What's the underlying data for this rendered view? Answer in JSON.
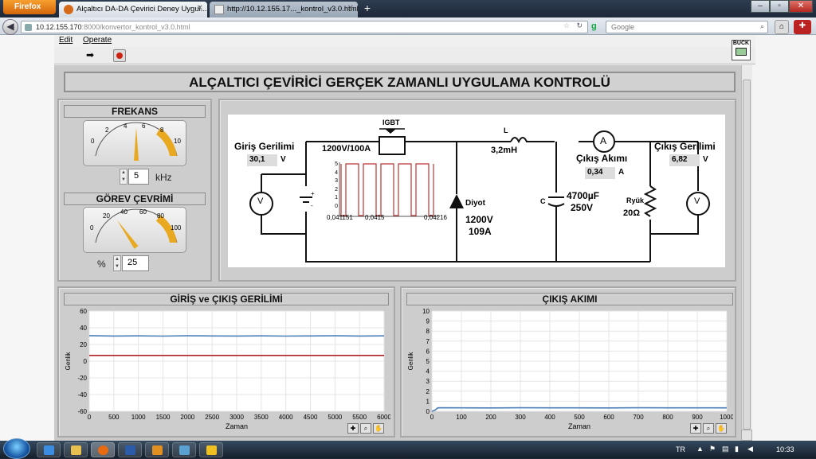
{
  "browser": {
    "firefox_label": "Firefox",
    "tabs": [
      {
        "label": "Alçaltıcı DA-DA Çevirici Deney Uygul...",
        "active": true
      },
      {
        "label": "http://10.12.155.17..._kontrol_v3.0.html",
        "active": false
      }
    ],
    "new_tab": "+",
    "url_host": "10.12.155.170",
    "url_rest": ":8000/konvertor_kontrol_v3.0.html",
    "search_placeholder": "Google",
    "window_buttons": [
      "–",
      "▫",
      "✕"
    ]
  },
  "menu": {
    "items": [
      "Edit",
      "Operate"
    ]
  },
  "badge": {
    "line1": "BUCK"
  },
  "title": "ALÇALTICI ÇEVİRİCİ GERÇEK ZAMANLI UYGULAMA KONTROLÜ",
  "frequency": {
    "title": "FREKANS",
    "scale": [
      "0",
      "2",
      "4",
      "6",
      "8",
      "10"
    ],
    "value": "5",
    "unit": "kHz",
    "needle": 5,
    "max": 10
  },
  "duty": {
    "title": "GÖREV ÇEVRİMİ",
    "scale": [
      "0",
      "20",
      "40",
      "60",
      "80",
      "100"
    ],
    "value": "25",
    "unit": "%",
    "needle": 25,
    "max": 100
  },
  "circuit": {
    "input_voltage_label": "Giriş Gerilimi",
    "input_voltage_value": "30,1",
    "input_voltage_unit": "V",
    "igbt_label": "IGBT",
    "igbt_rating": "1200V/100A",
    "inductor_label": "L",
    "inductor_value": "3,2mH",
    "diode_label": "Diyot",
    "diode_rating_v": "1200V",
    "diode_rating_a": "109A",
    "cap_label": "C",
    "cap_value": "4700µF",
    "cap_voltage": "250V",
    "current_label": "Çıkış Akımı",
    "current_value": "0,34",
    "current_unit": "A",
    "output_voltage_label": "Çıkış Gerilimi",
    "output_voltage_value": "6,82",
    "output_voltage_unit": "V",
    "load_label": "Ryük",
    "load_value": "20Ω",
    "ammeter_symbol": "A",
    "voltmeter_symbol": "V",
    "battery_plus": "+",
    "battery_minus": "-",
    "pwm": {
      "y_ticks": [
        "5",
        "4",
        "3",
        "2",
        "1",
        "0"
      ],
      "x_ticks": [
        "0,041151",
        "0,0415",
        "0,04216"
      ]
    }
  },
  "graph1": {
    "title": "GİRİŞ ve ÇIKIŞ GERİLİMİ",
    "xlabel": "Zaman",
    "ylabel": "Genlik"
  },
  "graph2": {
    "title": "ÇIKIŞ AKIMI",
    "xlabel": "Zaman",
    "ylabel": "Genlik"
  },
  "chart_data": [
    {
      "type": "line",
      "title": "GİRİŞ ve ÇIKIŞ GERİLİMİ",
      "xlabel": "Zaman",
      "ylabel": "Genlik",
      "xlim": [
        0,
        6000
      ],
      "ylim": [
        -60,
        60
      ],
      "x_ticks": [
        0,
        500,
        1000,
        1500,
        2000,
        2500,
        3000,
        3500,
        4000,
        4500,
        5000,
        5500,
        6000
      ],
      "y_ticks": [
        60,
        40,
        20,
        0,
        -20,
        -40,
        -60
      ],
      "series": [
        {
          "color": "#4a7fb8",
          "x": [
            0,
            500,
            1000,
            1500,
            2000,
            2500,
            3000,
            3500,
            4000,
            4500,
            5000,
            5500,
            6000
          ],
          "values": [
            30.5,
            30.1,
            30.3,
            30.0,
            30.4,
            30.2,
            30.1,
            30.3,
            30.0,
            30.2,
            30.4,
            30.1,
            30.3
          ]
        },
        {
          "color": "#b22222",
          "x": [
            0,
            6000
          ],
          "values": [
            6.8,
            6.8
          ]
        }
      ]
    },
    {
      "type": "line",
      "title": "ÇIKIŞ AKIMI",
      "xlabel": "Zaman",
      "ylabel": "Genlik",
      "xlim": [
        0,
        1000
      ],
      "ylim": [
        0,
        10
      ],
      "x_ticks": [
        0,
        100,
        200,
        300,
        400,
        500,
        600,
        700,
        800,
        900,
        1000
      ],
      "y_ticks": [
        10,
        9,
        8,
        7,
        6,
        5,
        4,
        3,
        2,
        1,
        0
      ],
      "series": [
        {
          "color": "#4a7fb8",
          "x": [
            0,
            10,
            20,
            30,
            100,
            200,
            300,
            400,
            500,
            600,
            700,
            800,
            900,
            1000
          ],
          "values": [
            0,
            0.1,
            0.34,
            0.35,
            0.34,
            0.33,
            0.35,
            0.34,
            0.34,
            0.33,
            0.35,
            0.34,
            0.34,
            0.34
          ]
        }
      ]
    }
  ],
  "taskbar": {
    "lang": "TR",
    "clock": "10:33"
  }
}
